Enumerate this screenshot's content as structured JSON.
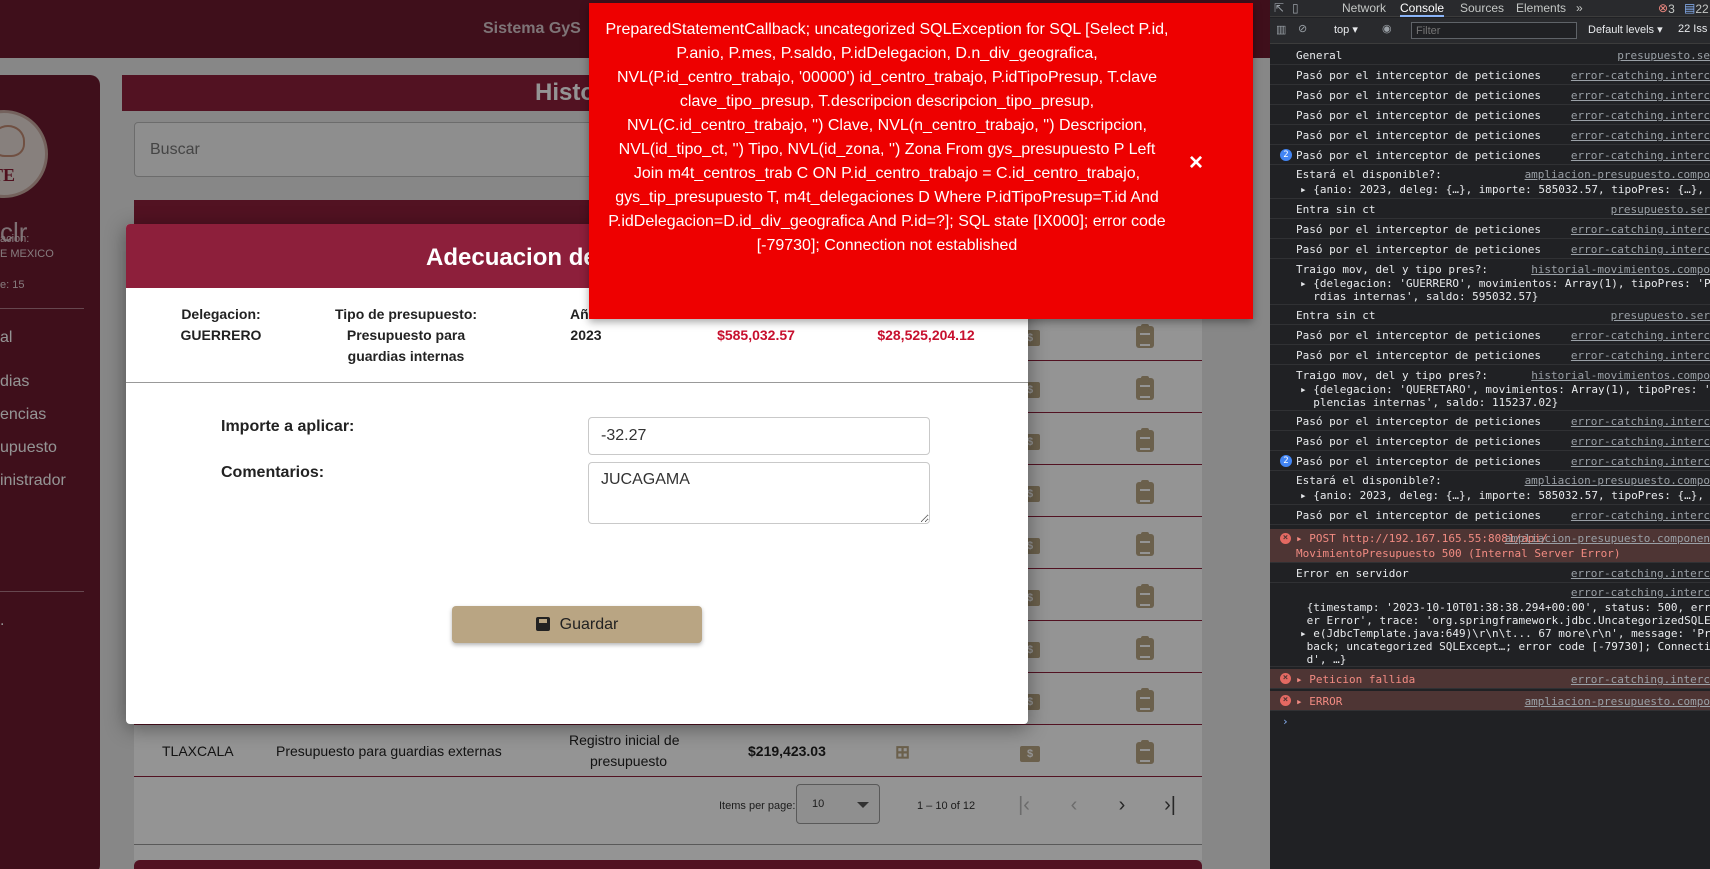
{
  "app": {
    "title": "Sistema GyS",
    "page_heading": "Histo"
  },
  "sidebar": {
    "user": "clr",
    "meta1": "acion:",
    "meta2": "E MEXICO",
    "meta3": "e: 15",
    "items": [
      "al",
      "dias",
      "encias",
      "upuesto",
      "inistrador"
    ],
    "footer": "."
  },
  "search": {
    "placeholder": "Buscar"
  },
  "table": {
    "last_row": {
      "delegacion": "TLAXCALA",
      "tipo": "Presupuesto para guardias externas",
      "movimiento_l1": "Registro inicial de",
      "movimiento_l2": "presupuesto",
      "importe": "$219,423.03"
    },
    "paginator": {
      "items_per_page_label": "Items per page:",
      "items_per_page": "10",
      "range": "1 – 10 of 12"
    }
  },
  "dialog": {
    "title": "Adecuacion de",
    "delegacion_label": "Delegacion:",
    "delegacion_value": "GUERRERO",
    "tipo_label": "Tipo de presupuesto:",
    "tipo_value_l1": "Presupuesto para",
    "tipo_value_l2": "guardias internas",
    "anio_label": "Año:",
    "anio_value": "2023",
    "saldo_value": "$585,032.57",
    "disponible_value": "$28,525,204.12",
    "importe_label": "Importe a aplicar:",
    "importe_value": "-32.27",
    "comentarios_label": "Comentarios:",
    "comentarios_value": "JUCAGAMA",
    "save_label": "Guardar"
  },
  "error_toast": {
    "message": "PreparedStatementCallback; uncategorized SQLException for SQL [Select P.id, P.anio, P.mes, P.saldo, P.idDelegacion, D.n_div_geografica, NVL(P.id_centro_trabajo, '00000') id_centro_trabajo, P.idTipoPresup, T.clave clave_tipo_presup, T.descripcion descripcion_tipo_presup, NVL(C.id_centro_trabajo, '') Clave, NVL(n_centro_trabajo, '') Descripcion, NVL(id_tipo_ct, '') Tipo, NVL(id_zona, '') Zona From gys_presupuesto P Left Join m4t_centros_trab C ON P.id_centro_trabajo = C.id_centro_trabajo, gys_tip_presupuesto T, m4t_delegaciones D Where P.idTipoPresup=T.id And P.idDelegacion=D.id_div_geografica And P.id=?]; SQL state [IX000]; error code [-79730]; Connection not established",
    "close": "×"
  },
  "devtools": {
    "tabs": [
      "Network",
      "Console",
      "Sources",
      "Elements"
    ],
    "more": "»",
    "errors": "3",
    "issues_badge": "22",
    "context": "top",
    "filter_placeholder": "Filter",
    "levels": "Default levels",
    "issues": "22 Iss",
    "logs": [
      {
        "badge": "",
        "text": "General",
        "src": "presupuesto.se"
      },
      {
        "badge": "",
        "text": "Pasó por el interceptor de peticiones",
        "src": "error-catching.interc"
      },
      {
        "badge": "",
        "text": "Pasó por el interceptor de peticiones",
        "src": "error-catching.interc"
      },
      {
        "badge": "",
        "text": "Pasó por el interceptor de peticiones",
        "src": "error-catching.interc"
      },
      {
        "badge": "",
        "text": "Pasó por el interceptor de peticiones",
        "src": "error-catching.interc"
      },
      {
        "badge": "2",
        "text": "Pasó por el interceptor de peticiones",
        "src": "error-catching.interc"
      }
    ],
    "log_disp1_a": "Estará el disponible?:",
    "log_disp1_src": "ampliacion-presupuesto.compo",
    "log_disp1_b": "▸ {anio: 2023, deleg: {…}, importe: 585032.57, tipoPres: {…}, id: 180,",
    "log_sinct1": "Entra sin ct",
    "log_sinct1_src": "presupuesto.ser",
    "log_b1": "Pasó por el interceptor de peticiones",
    "log_b1_src": "error-catching.interc",
    "log_b2": "Pasó por el interceptor de peticiones",
    "log_b2_src": "error-catching.interc",
    "log_traigo1_a": "Traigo mov, del y tipo pres?:",
    "log_traigo1_src": "historial-movimientos.compo",
    "log_traigo1_b": "▸ {delegacion: 'GUERRERO', movimientos: Array(1), tipoPres: 'Presupues",
    "log_traigo1_c": "  rdias internas', saldo: 595032.57}",
    "log_sinct2": "Entra sin ct",
    "log_sinct2_src": "presupuesto.ser",
    "log_c1": "Pasó por el interceptor de peticiones",
    "log_c1_src": "error-catching.interc",
    "log_c2": "Pasó por el interceptor de peticiones",
    "log_c2_src": "error-catching.interc",
    "log_traigo2_a": "Traigo mov, del y tipo pres?:",
    "log_traigo2_src": "historial-movimientos.compo",
    "log_traigo2_b": "▸ {delegacion: 'QUERETARO', movimientos: Array(1), tipoPres: 'Presupue",
    "log_traigo2_c": "  plencias internas', saldo: 115237.02}",
    "log_d1": "Pasó por el interceptor de peticiones",
    "log_d1_src": "error-catching.interc",
    "log_d2": "Pasó por el interceptor de peticiones",
    "log_d2_src": "error-catching.interc",
    "log_d3": "Pasó por el interceptor de peticiones",
    "log_d3_src": "error-catching.interc",
    "log_d3_badge": "2",
    "log_disp2_a": "Estará el disponible?:",
    "log_disp2_src": "ampliacion-presupuesto.compo",
    "log_disp2_b": "▸ {anio: 2023, deleg: {…}, importe: 585032.57, tipoPres: {…}, id: 179,",
    "log_d4": "Pasó por el interceptor de peticiones",
    "log_d4_src": "error-catching.interc",
    "log_post_a": "▸ POST http://192.167.165.55:8081/api/",
    "log_post_src": "ampliacion-presupuesto.componen",
    "log_post_b": "MovimientoPresupuesto 500 (Internal Server Error)",
    "log_srv": "Error en servidor",
    "log_srv_src": "error-catching.interc",
    "log_srv2_src": "error-catching.interc",
    "log_obj1": " {timestamp: '2023-10-10T01:38:38.294+00:00', status: 500, error: 'In",
    "log_obj2": " er Error', trace: 'org.springframework.jdbc.UncategorizedSQLExceptio",
    "log_obj3": "▸ e(JdbcTemplate.java:649)\\r\\n\\t... 67 more\\r\\n', message: 'PreparedSt",
    "log_obj4": " back; uncategorized SQLExcept…; error code [-79730]; Connection not",
    "log_obj5": " d', …}",
    "log_fallida": "▸ Peticion fallida",
    "log_fallida_src": "error-catching.interc",
    "log_error": "▸ ERROR",
    "log_error_src": "ampliacion-presupuesto.compo",
    "prompt": "›"
  }
}
